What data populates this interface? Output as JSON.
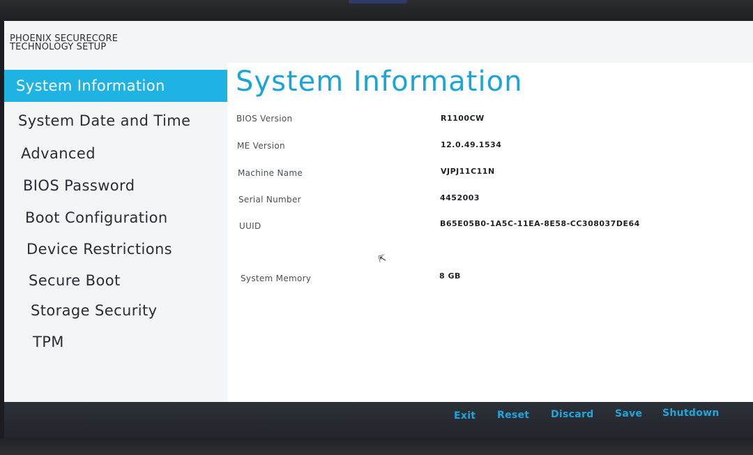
{
  "brand": {
    "line1": "PHOENIX SECURECORE",
    "line2": "TECHNOLOGY SETUP"
  },
  "sidebar": {
    "items": [
      {
        "label": "System Information",
        "active": true
      },
      {
        "label": "System Date and Time"
      },
      {
        "label": "Advanced"
      },
      {
        "label": "BIOS Password"
      },
      {
        "label": "Boot Configuration"
      },
      {
        "label": "Device Restrictions"
      },
      {
        "label": "Secure Boot"
      },
      {
        "label": "Storage Security"
      },
      {
        "label": "TPM"
      }
    ]
  },
  "main": {
    "title": "System Information",
    "rows": [
      {
        "label": "BIOS Version",
        "value": "R1100CW"
      },
      {
        "label": "ME Version",
        "value": "12.0.49.1534"
      },
      {
        "label": "Machine Name",
        "value": "VJPJ11C11N"
      },
      {
        "label": "Serial Number",
        "value": "4452003"
      },
      {
        "label": "UUID",
        "value": "B65E05B0-1A5C-11EA-8E58-CC308037DE64"
      },
      {
        "label": "System Memory",
        "value": "8 GB"
      }
    ]
  },
  "footer": {
    "buttons": [
      "Exit",
      "Reset",
      "Discard",
      "Save",
      "Shutdown"
    ]
  },
  "colors": {
    "accent": "#1fb3e4",
    "title": "#1aa5d8",
    "footer_bg": "#2c3038",
    "footer_text": "#1ea6dc"
  }
}
